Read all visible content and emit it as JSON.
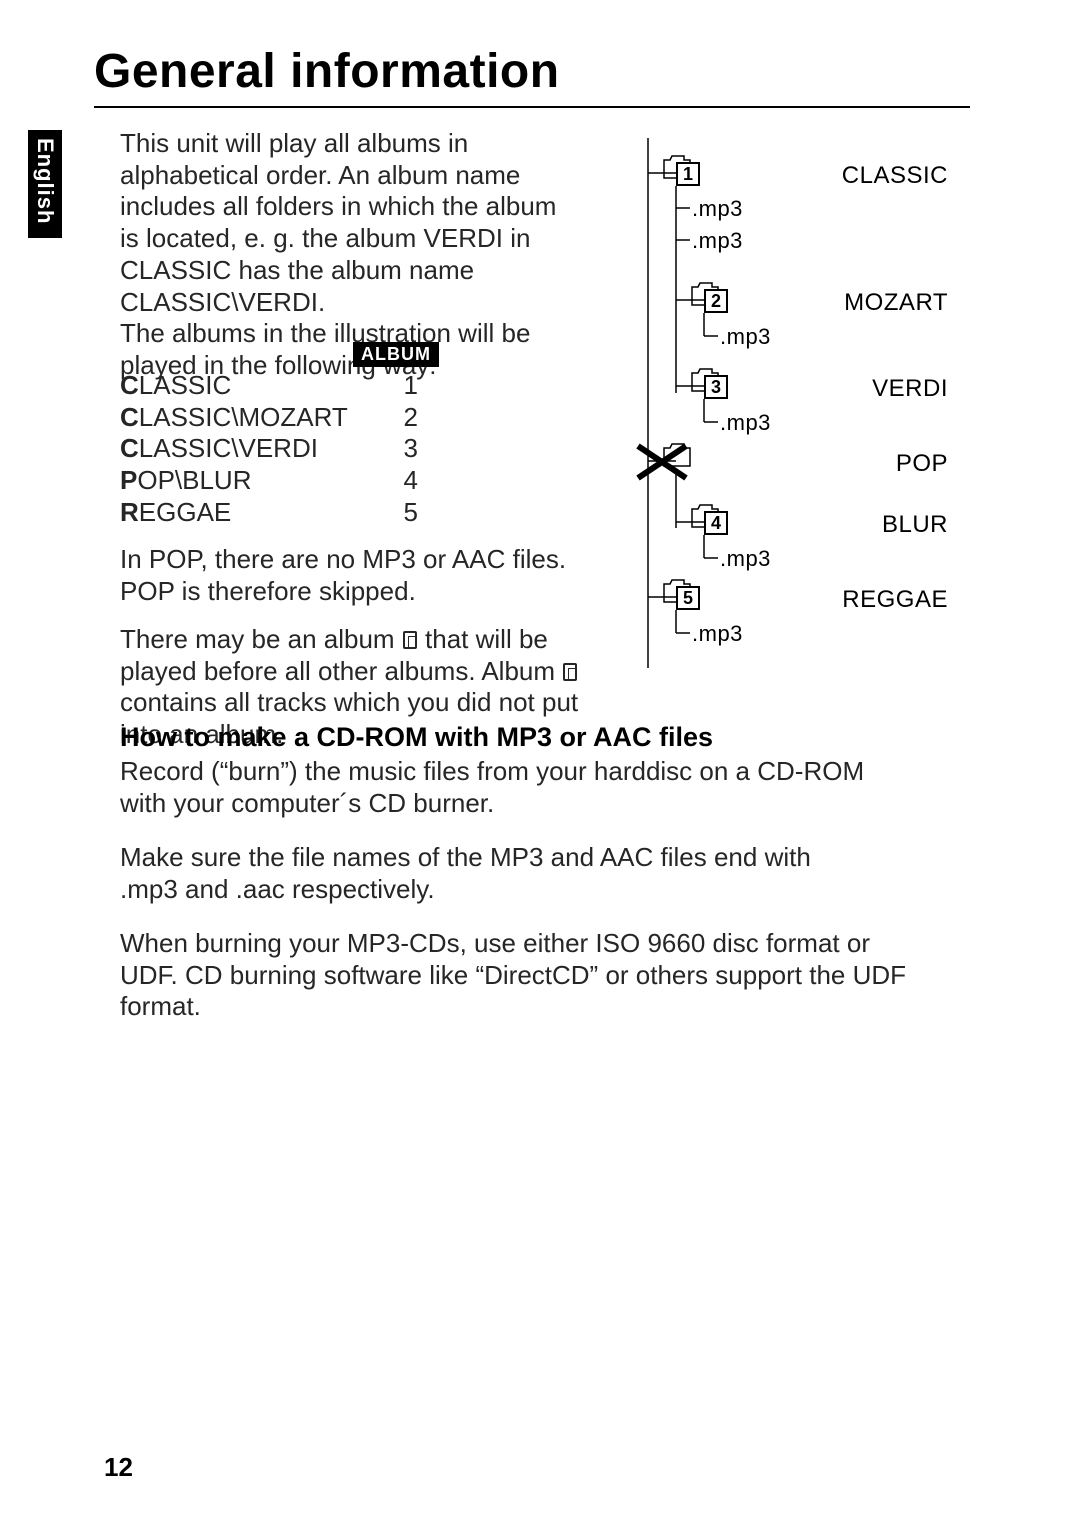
{
  "language_tab": "English",
  "page_title": "General information",
  "intro": "This unit will play all albums in alphabetical order. An album name includes all folders in which the album is located, e. g. the album VERDI in CLASSIC has the album name CLASSIC\\VERDI.\nThe albums in the illustration will be played in the following way:",
  "album_header": "ALBUM",
  "albums": [
    {
      "first": "C",
      "rest": "LASSIC",
      "num": "1"
    },
    {
      "first": "C",
      "rest": "LASSIC\\MOZART",
      "num": "2"
    },
    {
      "first": "C",
      "rest": "LASSIC\\VERDI",
      "num": "3"
    },
    {
      "first": "P",
      "rest": "OP\\BLUR",
      "num": "4"
    },
    {
      "first": "R",
      "rest": "EGGAE",
      "num": "5"
    }
  ],
  "pop_note": "In POP, there are no MP3 or AAC files. POP is therefore skipped.",
  "album0_pre": "There may be an album ",
  "album0_mid": " that will be played before all other albums. Album ",
  "album0_post": " contains all tracks which you did not put into an album.",
  "howto_heading": "How to make a CD-ROM with MP3 or AAC files",
  "howto_p1": "Record (“burn”) the music files from your harddisc on a CD-ROM with your computer´s CD burner.",
  "howto_p2": "Make sure the file names of the MP3 and AAC files end with .mp3 and .aac respectively.",
  "howto_p3": "When burning your MP3-CDs, use either ISO 9660 disc format or UDF. CD burning software like “DirectCD” or others support the UDF format.",
  "page_number": "12",
  "diagram": {
    "nodes": [
      {
        "badge": "1",
        "label": "CLASSIC"
      },
      {
        "badge": "2",
        "label": "MOZART"
      },
      {
        "badge": "3",
        "label": "VERDI"
      },
      {
        "badge": "",
        "label": "POP"
      },
      {
        "badge": "4",
        "label": "BLUR"
      },
      {
        "badge": "5",
        "label": "REGGAE"
      }
    ],
    "mp3_label": ".mp3"
  }
}
